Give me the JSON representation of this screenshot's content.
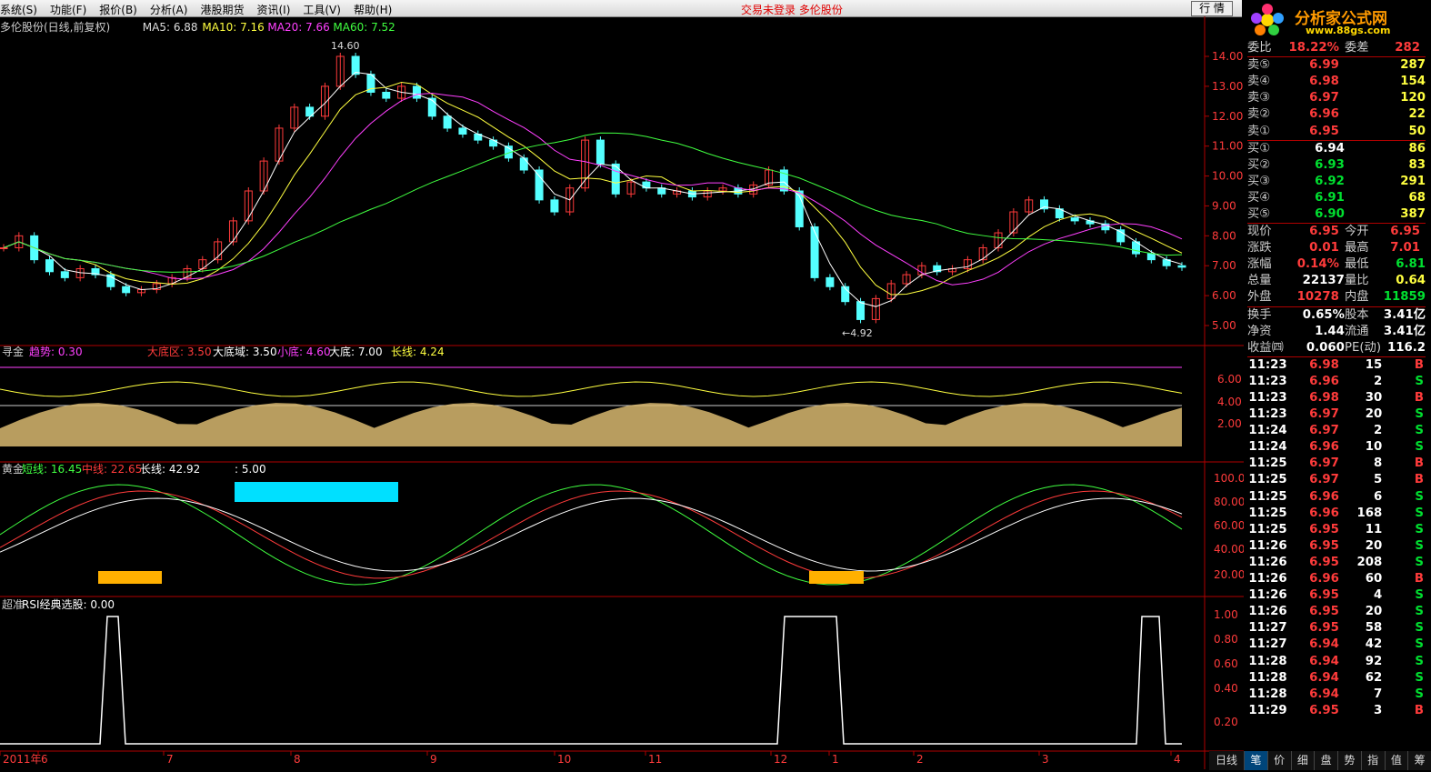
{
  "menus": [
    "系统(S)",
    "功能(F)",
    "报价(B)",
    "分析(A)",
    "港股期货",
    "资讯(I)",
    "工具(V)",
    "帮助(H)"
  ],
  "status": "交易未登录  多伦股份",
  "quote_button": "行 情",
  "logo": {
    "brand": "分析家公式网",
    "url": "www.88gs.com"
  },
  "main_header": {
    "title": "多伦股份(日线,前复权)",
    "ma5": "MA5: 6.88",
    "ma10": "MA10: 7.16",
    "ma20": "MA20: 7.66",
    "ma60": "MA60: 7.52",
    "high_label": "14.60",
    "low_label": "←4.92"
  },
  "price_axis": [
    "14.00",
    "13.00",
    "12.00",
    "11.00",
    "10.00",
    "9.00",
    "8.00",
    "7.00",
    "6.00",
    "5.00"
  ],
  "ind1": {
    "name": "寻金",
    "trend": "趋势: 0.30",
    "big_bottom_zone": "大底区: 3.50",
    "big_bottom_area": "大底域: 3.50",
    "small_bottom": "小底: 4.60",
    "big_bottom": "大底: 7.00",
    "long_line": "长线: 4.24",
    "axis": [
      "6.00",
      "4.00",
      "2.00"
    ]
  },
  "ind2": {
    "name": "黄金",
    "short": "短线: 16.45",
    "mid": "中线: 22.65",
    "long": "长线: 42.92",
    "extra": ": 5.00",
    "axis": [
      "100.0",
      "80.00",
      "60.00",
      "40.00",
      "20.00"
    ]
  },
  "ind3": {
    "name": "超准",
    "rsi": "RSI经典选股: 0.00",
    "axis": [
      "1.00",
      "0.80",
      "0.60",
      "0.40",
      "0.20"
    ]
  },
  "x_axis": [
    "2011年",
    "6",
    "7",
    "8",
    "9",
    "10",
    "11",
    "12",
    "1",
    "2",
    "3",
    "4"
  ],
  "quote_top": {
    "label1": "委比",
    "val1": "18.22%",
    "label2": "委差",
    "val2": "282"
  },
  "asks": [
    {
      "label": "卖⑤",
      "price": "6.99",
      "vol": "287"
    },
    {
      "label": "卖④",
      "price": "6.98",
      "vol": "154"
    },
    {
      "label": "卖③",
      "price": "6.97",
      "vol": "120"
    },
    {
      "label": "卖②",
      "price": "6.96",
      "vol": "22"
    },
    {
      "label": "卖①",
      "price": "6.95",
      "vol": "50"
    }
  ],
  "bids": [
    {
      "label": "买①",
      "price": "6.94",
      "vol": "86"
    },
    {
      "label": "买②",
      "price": "6.93",
      "vol": "83"
    },
    {
      "label": "买③",
      "price": "6.92",
      "vol": "291"
    },
    {
      "label": "买④",
      "price": "6.91",
      "vol": "68"
    },
    {
      "label": "买⑤",
      "price": "6.90",
      "vol": "387"
    }
  ],
  "stats": [
    {
      "l1": "现价",
      "v1": "6.95",
      "l2": "今开",
      "v2": "6.95"
    },
    {
      "l1": "涨跌",
      "v1": "0.01",
      "l2": "最高",
      "v2": "7.01"
    },
    {
      "l1": "涨幅",
      "v1": "0.14%",
      "l2": "最低",
      "v2": "6.81"
    },
    {
      "l1": "总量",
      "v1": "22137",
      "l2": "量比",
      "v2": "0.64"
    },
    {
      "l1": "外盘",
      "v1": "10278",
      "l2": "内盘",
      "v2": "11859"
    }
  ],
  "stats2": [
    {
      "l1": "换手",
      "v1": "0.65%",
      "l2": "股本",
      "v2": "3.41亿"
    },
    {
      "l1": "净资",
      "v1": "1.44",
      "l2": "流通",
      "v2": "3.41亿"
    },
    {
      "l1": "收益㈣",
      "v1": "0.060",
      "l2": "PE(动)",
      "v2": "116.2"
    }
  ],
  "ticks": [
    {
      "t": "11:23",
      "p": "6.98",
      "v": "15",
      "s": "B"
    },
    {
      "t": "11:23",
      "p": "6.96",
      "v": "2",
      "s": "S"
    },
    {
      "t": "11:23",
      "p": "6.98",
      "v": "30",
      "s": "B"
    },
    {
      "t": "11:23",
      "p": "6.97",
      "v": "20",
      "s": "S"
    },
    {
      "t": "11:24",
      "p": "6.97",
      "v": "2",
      "s": "S"
    },
    {
      "t": "11:24",
      "p": "6.96",
      "v": "10",
      "s": "S"
    },
    {
      "t": "11:25",
      "p": "6.97",
      "v": "8",
      "s": "B"
    },
    {
      "t": "11:25",
      "p": "6.97",
      "v": "5",
      "s": "B"
    },
    {
      "t": "11:25",
      "p": "6.96",
      "v": "6",
      "s": "S"
    },
    {
      "t": "11:25",
      "p": "6.96",
      "v": "168",
      "s": "S"
    },
    {
      "t": "11:25",
      "p": "6.95",
      "v": "11",
      "s": "S"
    },
    {
      "t": "11:26",
      "p": "6.95",
      "v": "20",
      "s": "S"
    },
    {
      "t": "11:26",
      "p": "6.95",
      "v": "208",
      "s": "S"
    },
    {
      "t": "11:26",
      "p": "6.96",
      "v": "60",
      "s": "B"
    },
    {
      "t": "11:26",
      "p": "6.95",
      "v": "4",
      "s": "S"
    },
    {
      "t": "11:26",
      "p": "6.95",
      "v": "20",
      "s": "S"
    },
    {
      "t": "11:27",
      "p": "6.95",
      "v": "58",
      "s": "S"
    },
    {
      "t": "11:27",
      "p": "6.94",
      "v": "42",
      "s": "S"
    },
    {
      "t": "11:28",
      "p": "6.94",
      "v": "92",
      "s": "S"
    },
    {
      "t": "11:28",
      "p": "6.94",
      "v": "62",
      "s": "S"
    },
    {
      "t": "11:28",
      "p": "6.94",
      "v": "7",
      "s": "S"
    },
    {
      "t": "11:29",
      "p": "6.95",
      "v": "3",
      "s": "B"
    }
  ],
  "period_tab": "日线",
  "tabs": [
    "笔",
    "价",
    "细",
    "盘",
    "势",
    "指",
    "值",
    "筹"
  ],
  "colors": {
    "up": "#ff3b3b",
    "down": "#54ffff",
    "ma5": "#ffffff",
    "ma10": "#ffff40",
    "ma20": "#ff40ff",
    "ma60": "#40ff40",
    "frame": "#b00000"
  }
}
